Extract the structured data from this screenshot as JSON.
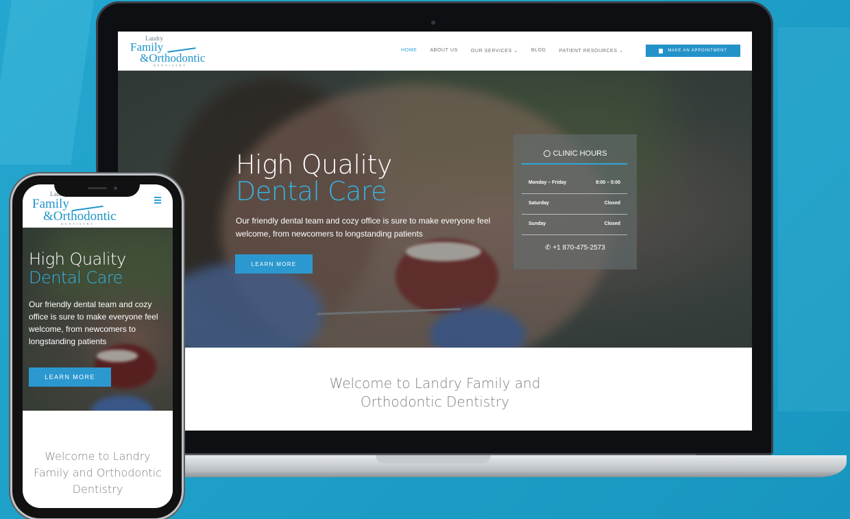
{
  "brand": {
    "logo_top": "Landry",
    "logo_main1": "Family",
    "logo_main2": "&Orthodontic",
    "logo_bottom": "DENTISTRY"
  },
  "nav": {
    "items": [
      "HOME",
      "ABOUT US",
      "OUR SERVICES ⌄",
      "BLOG",
      "PATIENT RESOURCES ⌄"
    ],
    "cta": "MAKE AN APPOINTMENT"
  },
  "hero": {
    "title_plain": "High Quality ",
    "title_accent": "Dental Care",
    "phone_title_plain": "High Quality",
    "subtitle": "Our friendly dental team and cozy office is sure to make everyone feel welcome, from newcomers to longstanding patients",
    "button": "LEARN MORE"
  },
  "clinic_hours": {
    "heading": "CLINIC HOURS",
    "rows": [
      {
        "day": "Monday – Friday",
        "hours": "8:00 – 5:00"
      },
      {
        "day": "Saturday",
        "hours": "Closed"
      },
      {
        "day": "Sunday",
        "hours": "Closed"
      }
    ],
    "phone": "+1 870-475-2573"
  },
  "welcome": {
    "laptop_line1": "Welcome to Landry Family and",
    "laptop_line2": "Orthodontic Dentistry",
    "phone_line1": "Welcome to Landry",
    "phone_line2": "Family and Orthodontic",
    "phone_line3": "Dentistry"
  },
  "colors": {
    "background": "#1fa0c8",
    "accent": "#2c98d0",
    "accent_light": "#36b3e3"
  }
}
